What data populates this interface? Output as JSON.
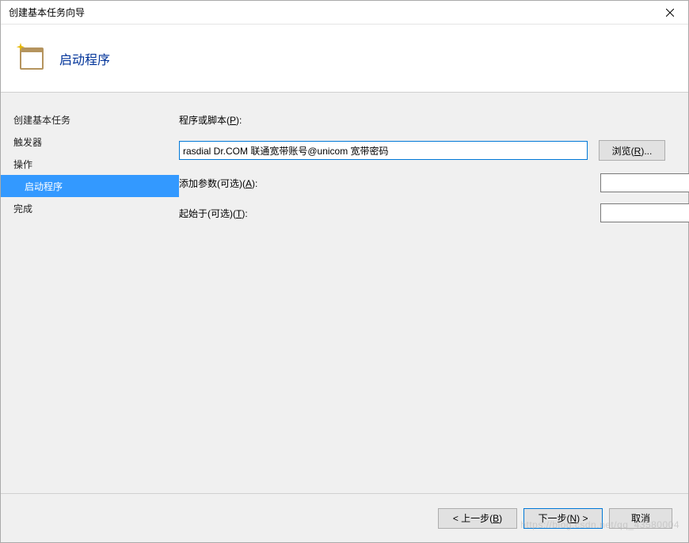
{
  "window": {
    "title": "创建基本任务向导"
  },
  "header": {
    "title": "启动程序"
  },
  "sidebar": {
    "items": [
      {
        "label": "创建基本任务",
        "selected": false,
        "sub": false
      },
      {
        "label": "触发器",
        "selected": false,
        "sub": false
      },
      {
        "label": "操作",
        "selected": false,
        "sub": false
      },
      {
        "label": "启动程序",
        "selected": true,
        "sub": true
      },
      {
        "label": "完成",
        "selected": false,
        "sub": false
      }
    ]
  },
  "main": {
    "program_label": "程序或脚本(",
    "program_hotkey": "P",
    "program_label_end": "):",
    "program_value": "rasdial Dr.COM 联通宽带账号@unicom 宽带密码",
    "browse_label": "浏览(",
    "browse_hotkey": "R",
    "browse_label_end": ")...",
    "args_label": "添加参数(可选)(",
    "args_hotkey": "A",
    "args_label_end": "):",
    "args_value": "",
    "startin_label": "起始于(可选)(",
    "startin_hotkey": "T",
    "startin_label_end": "):",
    "startin_value": ""
  },
  "footer": {
    "back": "< 上一步(",
    "back_hotkey": "B",
    "back_end": ")",
    "next": "下一步(",
    "next_hotkey": "N",
    "next_end": ") >",
    "cancel": "取消"
  },
  "watermark": "https://blog.csdn.net/qq_43580004"
}
